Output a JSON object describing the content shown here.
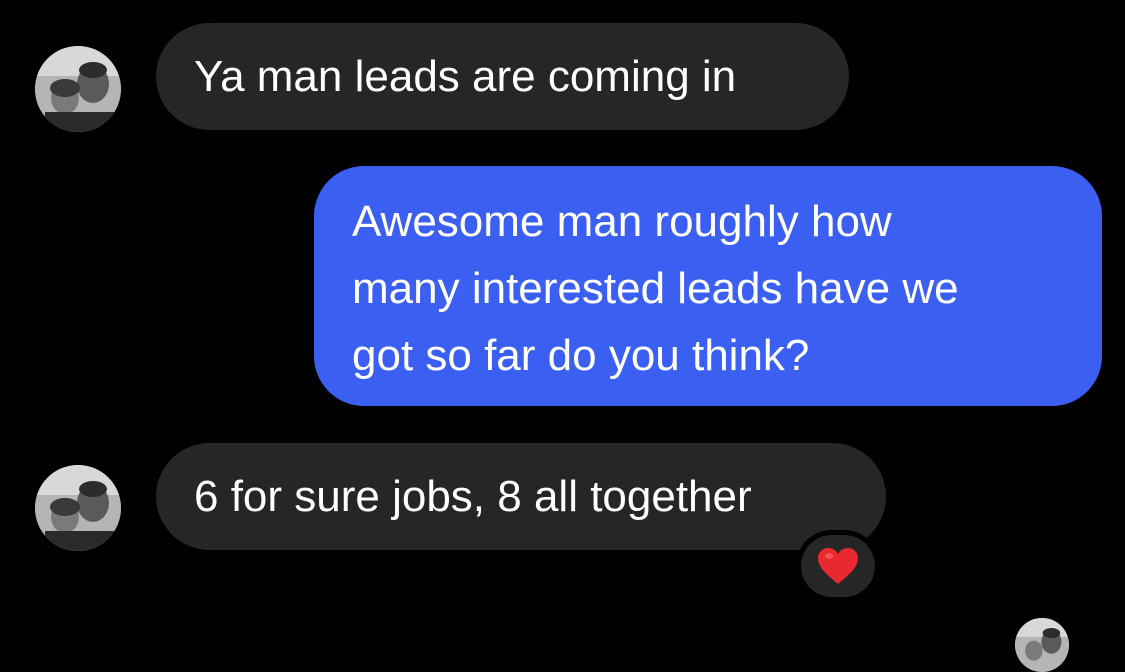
{
  "thread": {
    "messages": [
      {
        "direction": "incoming",
        "text": "Ya man leads are coming in"
      },
      {
        "direction": "outgoing",
        "lines": [
          "Awesome man roughly how",
          "many interested leads have we",
          "got so far do you think?"
        ]
      },
      {
        "direction": "incoming",
        "text": "6 for sure jobs, 8 all together",
        "reaction": "heart"
      }
    ]
  },
  "icons": {
    "avatar": "contact-avatar-photo",
    "reaction": "red-heart-icon"
  },
  "colors": {
    "background": "#000000",
    "incoming_bubble": "#262626",
    "outgoing_bubble": "#3b5ff0",
    "text": "#ffffff",
    "heart": "#e8292f"
  }
}
